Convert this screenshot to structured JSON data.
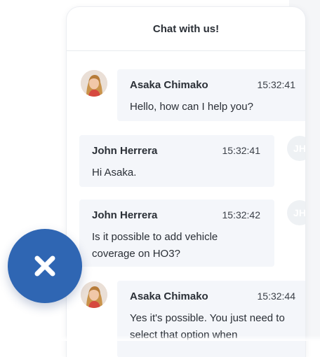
{
  "chat": {
    "title": "Chat with us!"
  },
  "messages": [
    {
      "sender": "Asaka Chimako",
      "time": "15:32:41",
      "text": "Hello, how can I help you?",
      "side": "left"
    },
    {
      "sender": "John Herrera",
      "time": "15:32:41",
      "text": "Hi Asaka.",
      "side": "right",
      "initials": "JH"
    },
    {
      "sender": "John Herrera",
      "time": "15:32:42",
      "text": "Is it possible to add vehicle coverage on HO3?",
      "side": "right",
      "initials": "JH"
    },
    {
      "sender": "Asaka Chimako",
      "time": "15:32:44",
      "text": "Yes it's possible. You just need to select that option when",
      "side": "left"
    }
  ],
  "close_button": {
    "icon": "close-icon",
    "color": "#2f66b3"
  },
  "colors": {
    "bubble": "#f4f6fa",
    "accent": "#2f66b3"
  }
}
